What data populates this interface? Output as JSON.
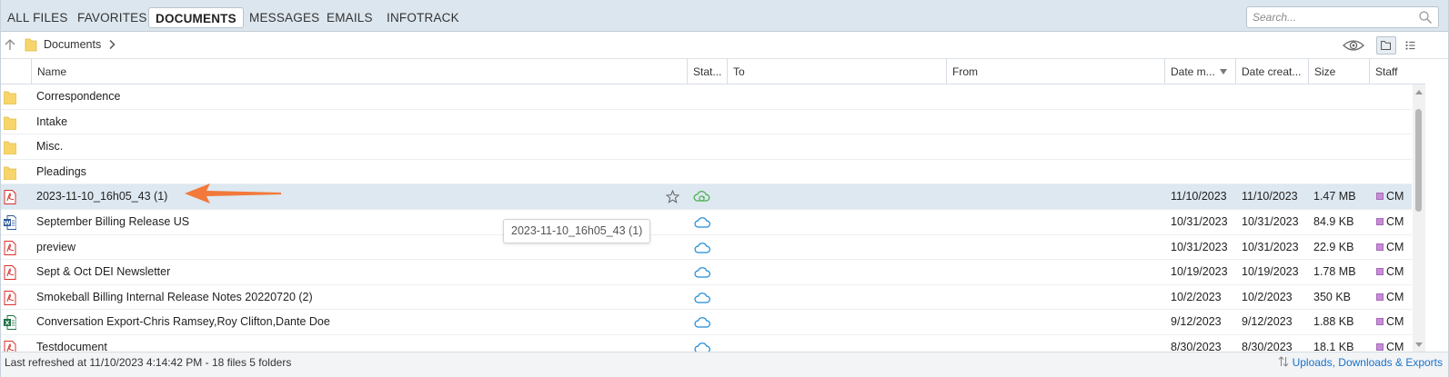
{
  "tabs": [
    {
      "label": "ALL FILES",
      "active": false
    },
    {
      "label": "FAVORITES",
      "active": false
    },
    {
      "label": "DOCUMENTS",
      "active": true
    },
    {
      "label": "MESSAGES",
      "active": false
    },
    {
      "label": "EMAILS",
      "active": false
    },
    {
      "label": "INFOTRACK",
      "active": false
    }
  ],
  "search": {
    "placeholder": "Search..."
  },
  "breadcrumb": {
    "label": "Documents"
  },
  "columns": {
    "name": "Name",
    "status": "Stat...",
    "to": "To",
    "from": "From",
    "date_modified": "Date m...",
    "date_created": "Date creat...",
    "size": "Size",
    "staff": "Staff"
  },
  "folders": [
    {
      "name": "Correspondence"
    },
    {
      "name": "Intake"
    },
    {
      "name": "Misc."
    },
    {
      "name": "Pleadings"
    }
  ],
  "files": [
    {
      "name": "2023-11-10_16h05_43 (1)",
      "type": "pdf",
      "status": "syncing",
      "modified": "11/10/2023",
      "created": "11/10/2023",
      "size": "1.47 MB",
      "staff": "CM",
      "selected": true
    },
    {
      "name": "September Billing Release US",
      "type": "word",
      "status": "cloud",
      "modified": "10/31/2023",
      "created": "10/31/2023",
      "size": "84.9 KB",
      "staff": "CM"
    },
    {
      "name": "preview",
      "type": "pdf",
      "status": "cloud",
      "modified": "10/31/2023",
      "created": "10/31/2023",
      "size": "22.9 KB",
      "staff": "CM"
    },
    {
      "name": "Sept & Oct DEI Newsletter",
      "type": "pdf",
      "status": "cloud",
      "modified": "10/19/2023",
      "created": "10/19/2023",
      "size": "1.78 MB",
      "staff": "CM"
    },
    {
      "name": "Smokeball Billing Internal Release Notes 20220720 (2)",
      "type": "pdf",
      "status": "cloud",
      "modified": "10/2/2023",
      "created": "10/2/2023",
      "size": "350 KB",
      "staff": "CM"
    },
    {
      "name": "Conversation Export-Chris Ramsey,Roy Clifton,Dante Doe",
      "type": "excel",
      "status": "cloud",
      "modified": "9/12/2023",
      "created": "9/12/2023",
      "size": "1.88 KB",
      "staff": "CM"
    },
    {
      "name": "Testdocument",
      "type": "pdf",
      "status": "cloud",
      "modified": "8/30/2023",
      "created": "8/30/2023",
      "size": "18.1 KB",
      "staff": "CM"
    }
  ],
  "tooltip": {
    "text": "2023-11-10_16h05_43 (1)"
  },
  "status": {
    "refreshed": "Last refreshed at 11/10/2023 4:14:42 PM",
    "separator": " - ",
    "counts": "18 files 5 folders",
    "uploads_link": "Uploads, Downloads & Exports"
  },
  "colors": {
    "tabbar_bg": "#dce6ee",
    "selected_row": "#dde8f1",
    "folder_yellow": "#f7d56b",
    "pdf_red": "#d9302c",
    "word_blue": "#2b5797",
    "excel_green": "#1e7145",
    "cloud_blue": "#1c8ad8",
    "sync_green": "#4caf50",
    "annotation_orange": "#f2793a",
    "link_blue": "#1a73c8"
  }
}
